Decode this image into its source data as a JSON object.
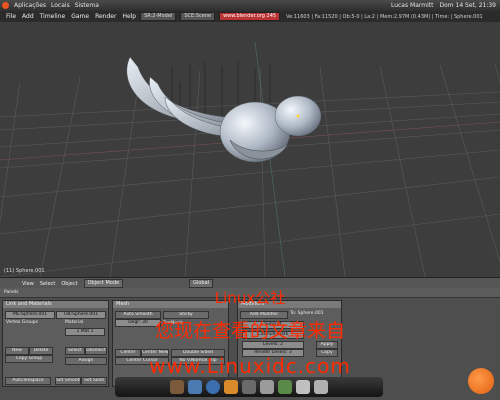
{
  "system_bar": {
    "apps": "Aplicações",
    "places": "Locais",
    "system": "Sistema",
    "user": "Lucas Marmitt",
    "clock": "Dom 14 Set, 21:39"
  },
  "blender_menu": {
    "items": [
      "File",
      "Add",
      "Timeline",
      "Game",
      "Render",
      "Help"
    ],
    "screen_field": "SR:2-Model",
    "scene_field": "SCE:Scene",
    "url_field": "www.blender.org 245",
    "stats": "Ve:11603 | Fa:11520 | Ob:5-0 | La:2 | Mem:2.97M (0.43M) | Time: | Sphere.001"
  },
  "viewport": {
    "status": "(11) Sphere.001"
  },
  "view_header": {
    "view": "View",
    "select": "Select",
    "object": "Object",
    "mode": "Object Mode",
    "pivot": "Global"
  },
  "buttons_window": {
    "panels_label": "Panels",
    "link_panel": {
      "title": "Link and Materials",
      "me_field": "ME:Sphere.001",
      "ob_field": "OB:Sphere.001",
      "vertex_groups": "Vertex Groups",
      "material": "Material",
      "mat_index": "1 Mat 1",
      "new": "New",
      "delete": "Delete",
      "select": "Select",
      "deselect": "Deselect",
      "copy_group": "Copy Group",
      "assign": "Assign",
      "auto_smooth": "AutoTexSpace",
      "set_smooth": "Set Smooth",
      "set_solid": "Set Solid"
    },
    "mesh_panel": {
      "title": "Mesh",
      "auto_smooth": "Auto Smooth",
      "degr": "Degr: 30",
      "sticky": "Sticky",
      "tex_mesh": "TexMesh:",
      "center": "Center",
      "center_new": "Center New",
      "center_cursor": "Center Cursor",
      "double_sided": "Double Sided",
      "no_vnormal_flip": "No V.Normal Flip"
    },
    "modifiers_panel": {
      "title": "Modifiers",
      "add_modifier": "Add Modifier",
      "to": "To: Sphere.001",
      "subsurf": "Subsurf",
      "catmull": "Catmull-Clark",
      "levels": "Levels: 2",
      "render_levels": "Render Levels: 3",
      "apply": "Apply",
      "copy": "Copy"
    }
  },
  "watermark": {
    "line1": "Linux公社",
    "line2": "您现在查看的文章来自",
    "line3": "www.Linuxidc.com"
  },
  "colors": {
    "viewport_bg": "#3d3d3d",
    "watermark": "#ff2a00",
    "ubuntu": "#e95420"
  }
}
